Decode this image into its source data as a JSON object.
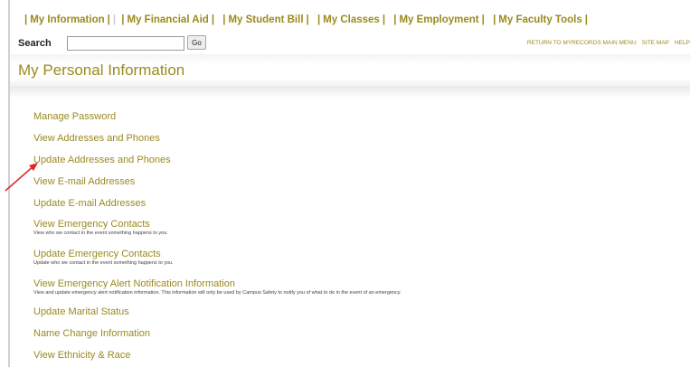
{
  "nav": {
    "items": [
      "My Information",
      "My Financial Aid",
      "My Student Bill",
      "My Classes",
      "My Employment",
      "My Faculty Tools"
    ]
  },
  "search": {
    "label": "Search",
    "value": "",
    "placeholder": "",
    "button": "Go"
  },
  "util_links": [
    "RETURN TO MYRECORDS MAIN MENU",
    "SITE MAP",
    "HELP"
  ],
  "page_title": "My Personal Information",
  "menu": [
    {
      "label": "Manage Password",
      "desc": ""
    },
    {
      "label": "View Addresses and Phones",
      "desc": ""
    },
    {
      "label": "Update Addresses and Phones",
      "desc": ""
    },
    {
      "label": "View E-mail Addresses",
      "desc": ""
    },
    {
      "label": "Update E-mail Addresses",
      "desc": ""
    },
    {
      "label": "View Emergency Contacts",
      "desc": "View who we contact in the event something happens to you."
    },
    {
      "label": "Update Emergency Contacts",
      "desc": "Update who we contact in the event something happens to you."
    },
    {
      "label": "View Emergency Alert Notification Information",
      "desc": "View and update emergency alert notification information. This information will only be used by Campus Safety to notify you of what to do in the event of an emergency."
    },
    {
      "label": "Update Marital Status",
      "desc": ""
    },
    {
      "label": "Name Change Information",
      "desc": ""
    },
    {
      "label": "View Ethnicity & Race",
      "desc": ""
    }
  ],
  "colors": {
    "link": "#9a8a1e",
    "arrow": "#e0262b"
  }
}
